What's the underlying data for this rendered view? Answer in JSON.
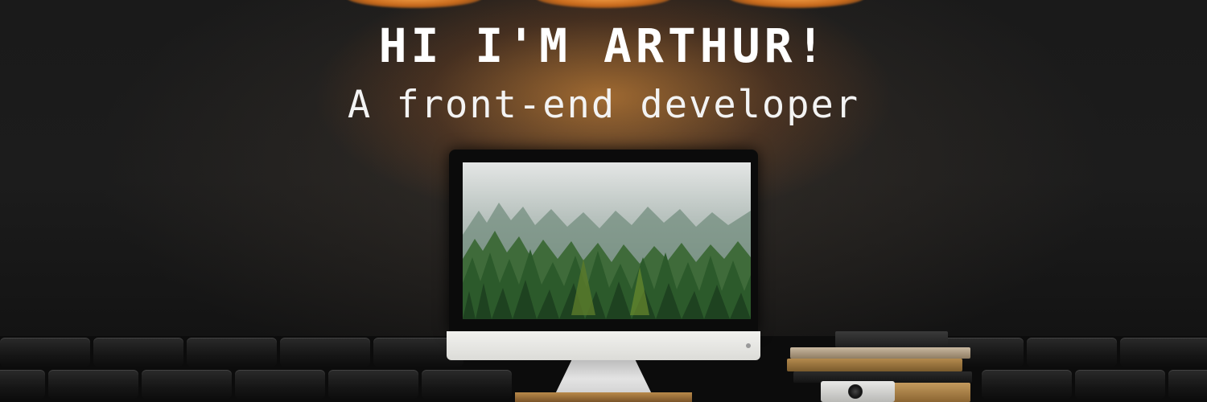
{
  "hero": {
    "title": "HI I'M ARTHUR!",
    "subtitle": "A front-end developer"
  },
  "colors": {
    "text": "#ffffff",
    "wall": "#1a1a1a",
    "lamp_glow": "#f7a44a"
  },
  "images": {
    "monitor": "desktop-monitor-image",
    "screen": "misty-forest-wallpaper",
    "books": "stacked-books-image",
    "camera": "camera-image"
  }
}
